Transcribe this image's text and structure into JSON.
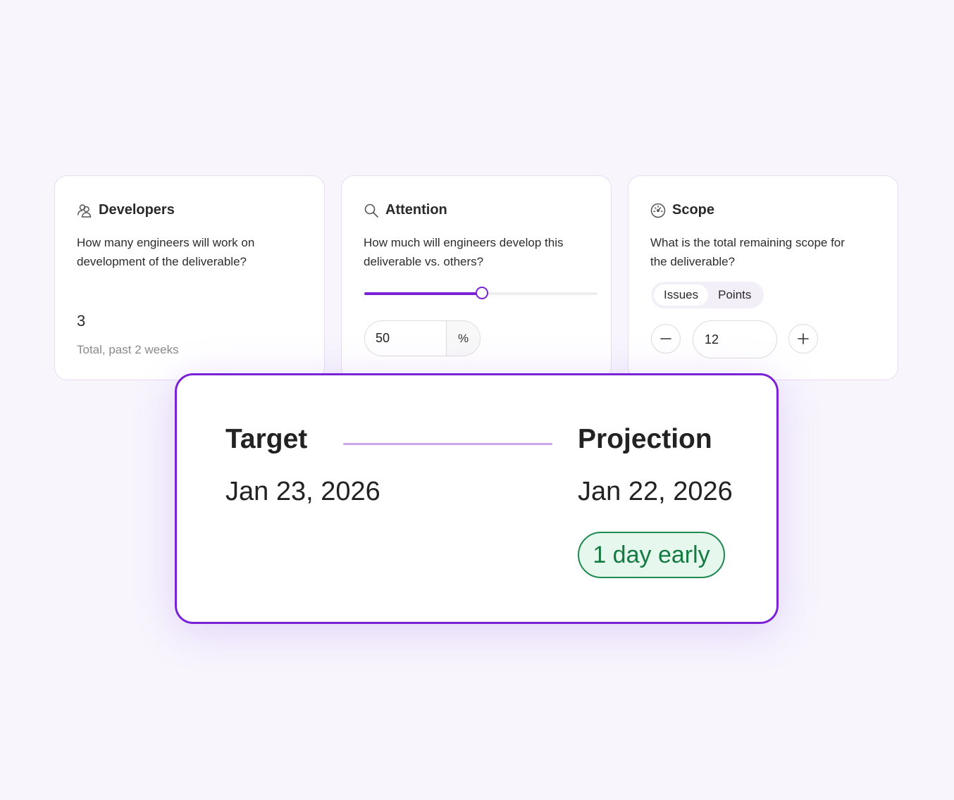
{
  "developers": {
    "title": "Developers",
    "question": "How many engineers will work on development of the deliverable?",
    "value": "3",
    "note": "Total, past 2 weeks"
  },
  "attention": {
    "title": "Attention",
    "question": "How much will engineers develop this deliverable vs. others?",
    "slider_percent": 50,
    "value": "50",
    "unit": "%"
  },
  "scope": {
    "title": "Scope",
    "question": "What is the total remaining scope for the deliverable?",
    "toggle_options": [
      "Issues",
      "Points"
    ],
    "selected_option": "Issues",
    "value": "12"
  },
  "summary": {
    "target_label": "Target",
    "target_date": "Jan 23, 2026",
    "projection_label": "Projection",
    "projection_date": "Jan 22, 2026",
    "status": "1 day early"
  },
  "colors": {
    "accent": "#7a22d6",
    "success": "#157a42",
    "success_bg": "#e6f8ee",
    "background": "#f8f5fd"
  }
}
